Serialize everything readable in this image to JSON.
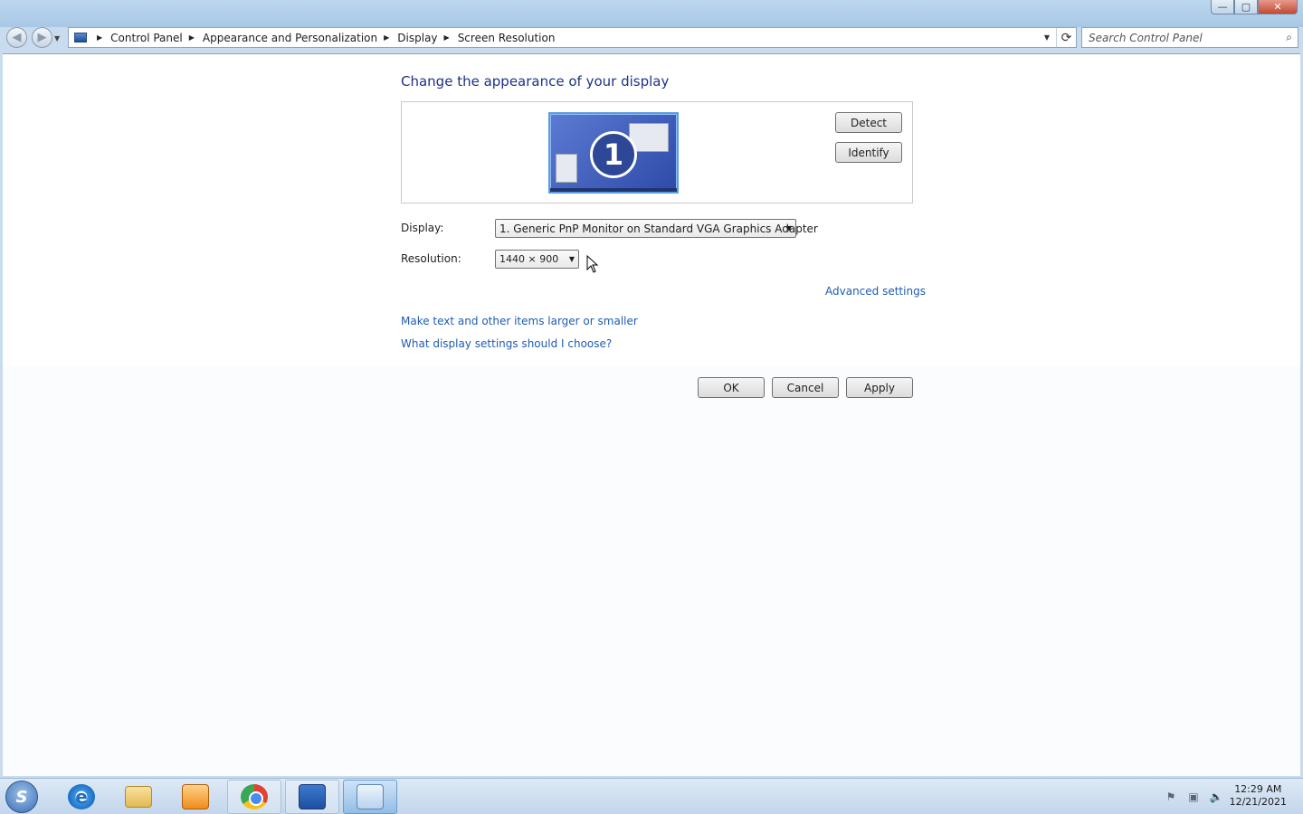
{
  "window": {
    "caption_buttons": {
      "minimize": "—",
      "maximize": "▢",
      "close": "✕"
    }
  },
  "addressbar": {
    "breadcrumbs": [
      "Control Panel",
      "Appearance and Personalization",
      "Display",
      "Screen Resolution"
    ],
    "search_placeholder": "Search Control Panel"
  },
  "main": {
    "title": "Change the appearance of your display",
    "monitor_number": "1",
    "detect_label": "Detect",
    "identify_label": "Identify",
    "display_label": "Display:",
    "display_value": "1. Generic PnP Monitor on Standard VGA Graphics Adapter",
    "resolution_label": "Resolution:",
    "resolution_value": "1440 × 900",
    "advanced_link": "Advanced settings",
    "link_text_size": "Make text and other items larger or smaller",
    "link_help": "What display settings should I choose?",
    "ok_label": "OK",
    "cancel_label": "Cancel",
    "apply_label": "Apply"
  },
  "taskbar": {
    "items": [
      "internet-explorer",
      "windows-explorer",
      "media-player",
      "chrome",
      "stacked-windows",
      "control-panel"
    ],
    "active_item": "control-panel",
    "tray_icons": [
      "action-center-flag",
      "network",
      "volume"
    ],
    "time": "12:29 AM",
    "date": "12/21/2021"
  }
}
